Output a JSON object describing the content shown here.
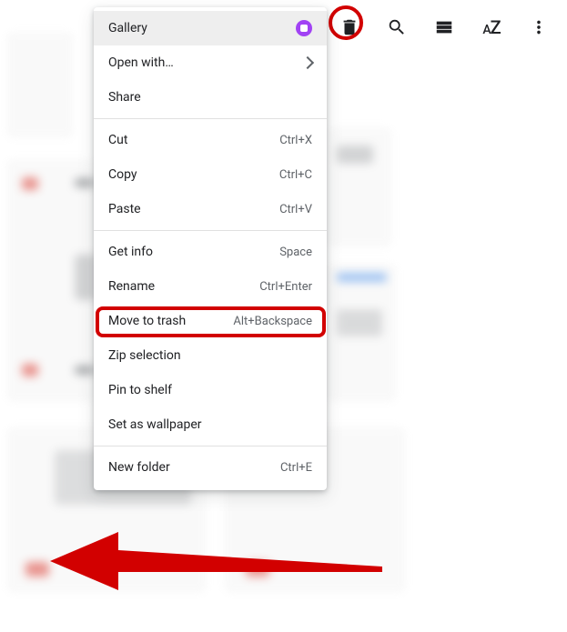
{
  "toolbar": {
    "trash_icon": "trash",
    "search_icon": "search",
    "list_icon": "list-view",
    "sort_label": "AZ",
    "more_icon": "more-vertical"
  },
  "menu": {
    "items": [
      {
        "label": "Gallery",
        "shortcut": "",
        "has_arrow": false,
        "highlighted": true,
        "has_badge": true
      },
      {
        "label": "Open with…",
        "shortcut": "",
        "has_arrow": true,
        "highlighted": false,
        "has_badge": false
      },
      {
        "label": "Share",
        "shortcut": "",
        "has_arrow": false,
        "highlighted": false,
        "has_badge": false
      },
      {
        "divider": true
      },
      {
        "label": "Cut",
        "shortcut": "Ctrl+X",
        "has_arrow": false,
        "highlighted": false,
        "has_badge": false
      },
      {
        "label": "Copy",
        "shortcut": "Ctrl+C",
        "has_arrow": false,
        "highlighted": false,
        "has_badge": false
      },
      {
        "label": "Paste",
        "shortcut": "Ctrl+V",
        "has_arrow": false,
        "highlighted": false,
        "has_badge": false
      },
      {
        "divider": true
      },
      {
        "label": "Get info",
        "shortcut": "Space",
        "has_arrow": false,
        "highlighted": false,
        "has_badge": false
      },
      {
        "label": "Rename",
        "shortcut": "Ctrl+Enter",
        "has_arrow": false,
        "highlighted": false,
        "has_badge": false
      },
      {
        "label": "Move to trash",
        "shortcut": "Alt+Backspace",
        "has_arrow": false,
        "highlighted": false,
        "has_badge": false
      },
      {
        "label": "Zip selection",
        "shortcut": "",
        "has_arrow": false,
        "highlighted": false,
        "has_badge": false
      },
      {
        "label": "Pin to shelf",
        "shortcut": "",
        "has_arrow": false,
        "highlighted": false,
        "has_badge": false
      },
      {
        "label": "Set as wallpaper",
        "shortcut": "",
        "has_arrow": false,
        "highlighted": false,
        "has_badge": false
      },
      {
        "divider": true
      },
      {
        "label": "New folder",
        "shortcut": "Ctrl+E",
        "has_arrow": false,
        "highlighted": false,
        "has_badge": false
      }
    ]
  },
  "annotations": {
    "red_circle_target": "trash-icon",
    "red_box_target": "Move to trash",
    "arrow_direction": "left"
  }
}
